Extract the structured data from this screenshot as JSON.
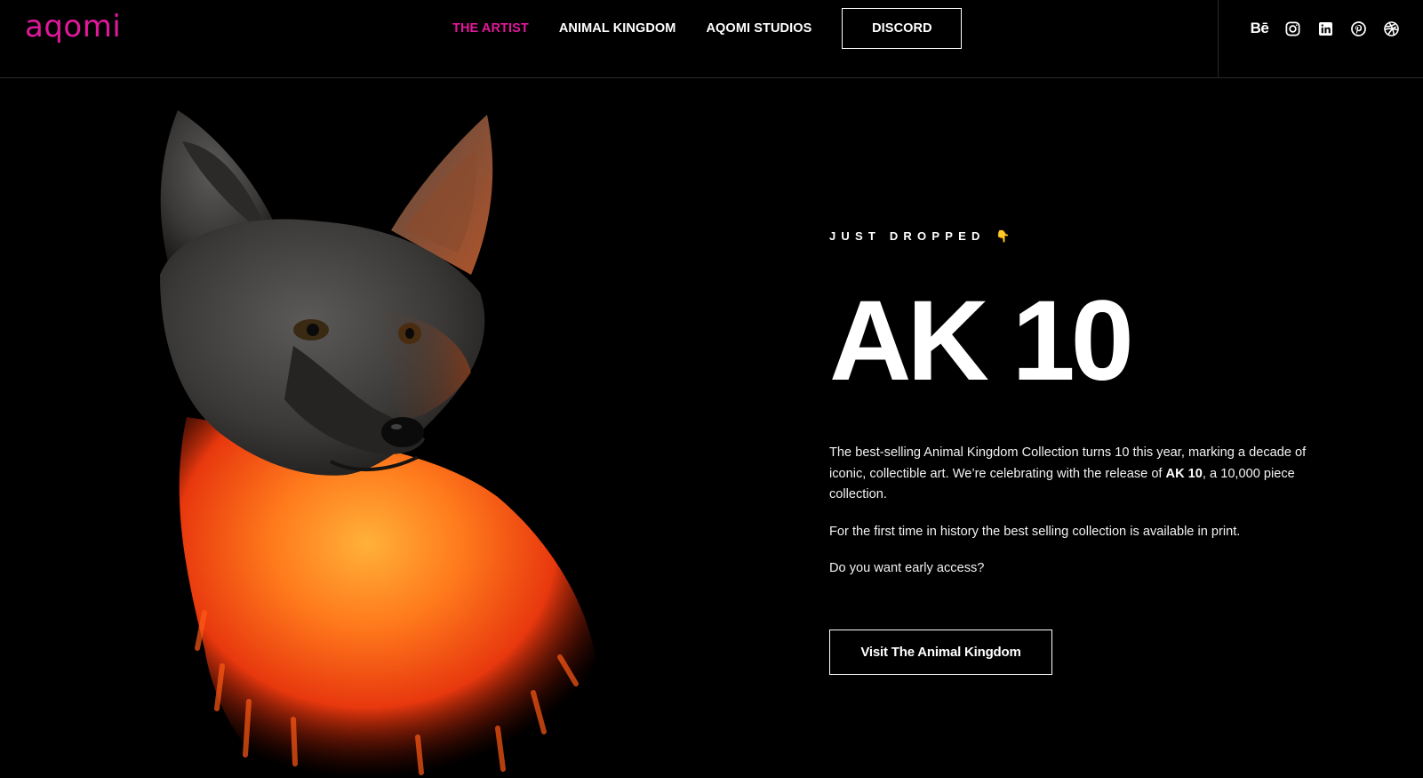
{
  "header": {
    "logo": "aqomi",
    "nav": [
      {
        "label": "THE ARTIST",
        "active": true
      },
      {
        "label": "ANIMAL KINGDOM",
        "active": false
      },
      {
        "label": "AQOMI STUDIOS",
        "active": false
      }
    ],
    "discord_label": "DISCORD",
    "social_icons": [
      "behance-icon",
      "instagram-icon",
      "linkedin-icon",
      "pinterest-icon",
      "dribbble-icon"
    ],
    "behance_text": "Bē"
  },
  "hero": {
    "eyebrow": "JUST DROPPED",
    "eyebrow_emoji": "👇",
    "title": "AK 10",
    "paragraph1_a": "The best-selling Animal Kingdom Collection turns 10 this year, marking a decade of iconic, collectible art. We’re celebrating with the release of ",
    "paragraph1_bold": "AK 10",
    "paragraph1_b": ", a 10,000 piece collection.",
    "paragraph2": "For the first time in history the best selling collection is available in print.",
    "paragraph3": "Do you want early access?",
    "cta_label": "Visit The Animal Kingdom"
  },
  "colors": {
    "background": "#000000",
    "accent": "#e0189a",
    "text": "#ffffff",
    "fox_fire": "#ff6a1a"
  }
}
